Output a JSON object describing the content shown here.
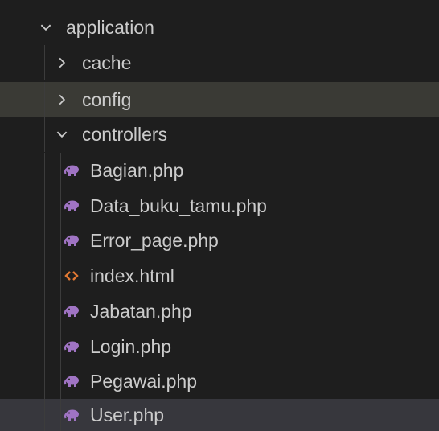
{
  "explorer": {
    "folders": {
      "application": "application",
      "cache": "cache",
      "config": "config",
      "controllers": "controllers"
    },
    "files": [
      {
        "name": "Bagian.php",
        "icon": "php-elephant-icon"
      },
      {
        "name": "Data_buku_tamu.php",
        "icon": "php-elephant-icon"
      },
      {
        "name": "Error_page.php",
        "icon": "php-elephant-icon"
      },
      {
        "name": "index.html",
        "icon": "html-code-icon"
      },
      {
        "name": "Jabatan.php",
        "icon": "php-elephant-icon"
      },
      {
        "name": "Login.php",
        "icon": "php-elephant-icon"
      },
      {
        "name": "Pegawai.php",
        "icon": "php-elephant-icon"
      },
      {
        "name": "User.php",
        "icon": "php-elephant-icon"
      }
    ],
    "colors": {
      "background": "#1e1e1e",
      "text": "#cccccc",
      "php_icon": "#a074c4",
      "html_icon": "#e37933",
      "hover_row": "#3a3a35",
      "selected_row": "#37373d"
    }
  }
}
